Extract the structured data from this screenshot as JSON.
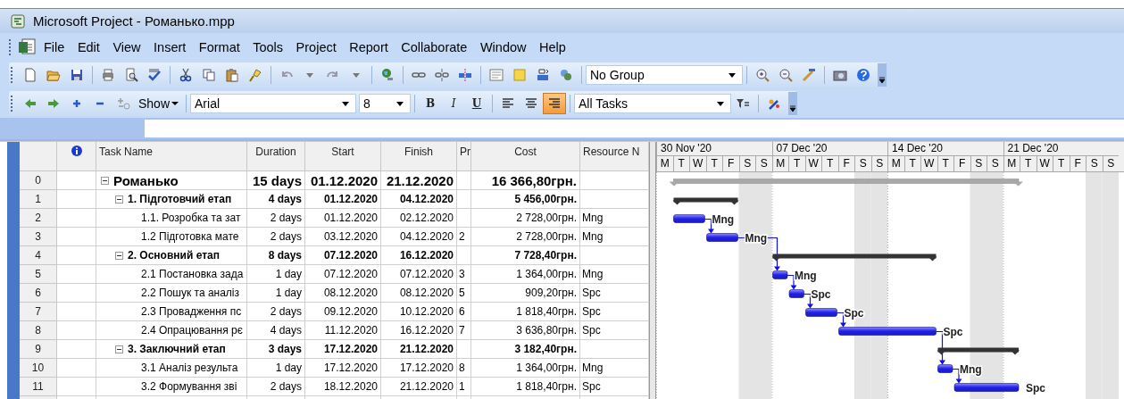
{
  "window": {
    "title": "Microsoft Project - Романько.mpp"
  },
  "menu": [
    "File",
    "Edit",
    "View",
    "Insert",
    "Format",
    "Tools",
    "Project",
    "Report",
    "Collaborate",
    "Window",
    "Help"
  ],
  "standard_toolbar": {
    "group_combo": "No Group"
  },
  "formatting_toolbar": {
    "show_button": "Show",
    "font_combo": "Arial",
    "size_combo": "8",
    "style_buttons": [
      "B",
      "I",
      "U"
    ],
    "align_buttons": [
      {
        "selected": false
      },
      {
        "selected": false
      },
      {
        "selected": true
      }
    ],
    "filter_combo": "All Tasks"
  },
  "table": {
    "columns": [
      "Task Name",
      "Duration",
      "Start",
      "Finish",
      "Pr",
      "Cost",
      "Resource N"
    ],
    "tasks": [
      {
        "id": "0",
        "name": "Романько",
        "duration": "15 days",
        "start": "01.12.2020",
        "finish": "21.12.2020",
        "cost": "16 366,80грн.",
        "expanded": true,
        "children": [
          {
            "id": "1",
            "name": "1. Підготовчий етап",
            "duration": "4 days",
            "start": "01.12.2020",
            "finish": "04.12.2020",
            "cost": "5 456,00грн.",
            "expanded": true,
            "children": [
              {
                "id": "2",
                "name": "1.1. Розробка та зат",
                "duration": "2 days",
                "start": "01.12.2020",
                "finish": "02.12.2020",
                "cost": "2 728,00грн.",
                "resource": "Mng",
                "bar_label": "Mng",
                "link_arrow_in": false
              },
              {
                "id": "3",
                "name": "1.2 Підготовка мате",
                "duration": "2 days",
                "start": "03.12.2020",
                "finish": "04.12.2020",
                "predecessors": "2",
                "cost": "2 728,00грн.",
                "resource": "Mng",
                "bar_label": "Mng",
                "link_arrow_in": true
              }
            ]
          },
          {
            "id": "4",
            "name": "2. Основний етап",
            "duration": "8 days",
            "start": "07.12.2020",
            "finish": "16.12.2020",
            "cost": "7 728,40грн.",
            "expanded": true,
            "children": [
              {
                "id": "5",
                "name": "2.1 Постановка зада",
                "duration": "1 day",
                "start": "07.12.2020",
                "finish": "07.12.2020",
                "predecessors": "3",
                "cost": "1 364,00грн.",
                "resource": "Mng",
                "bar_label": "Mng",
                "link_arrow_in": true
              },
              {
                "id": "6",
                "name": "2.2 Пошук та аналіз",
                "duration": "1 day",
                "start": "08.12.2020",
                "finish": "08.12.2020",
                "predecessors": "5",
                "cost": "909,20грн.",
                "resource": "Spc",
                "bar_label": "Spc",
                "link_arrow_in": true
              },
              {
                "id": "7",
                "name": "2.3 Провадження пс",
                "duration": "2 days",
                "start": "09.12.2020",
                "finish": "10.12.2020",
                "predecessors": "6",
                "cost": "1 818,40грн.",
                "resource": "Spc",
                "bar_label": "Spc",
                "link_arrow_in": true
              },
              {
                "id": "8",
                "name": "2.4 Опрацювання рє",
                "duration": "4 days",
                "start": "11.12.2020",
                "finish": "16.12.2020",
                "predecessors": "7",
                "cost": "3 636,80грн.",
                "resource": "Spc",
                "bar_label": "Spc",
                "link_arrow_in": true
              }
            ]
          },
          {
            "id": "9",
            "name": "3. Заключний етап",
            "duration": "3 days",
            "start": "17.12.2020",
            "finish": "21.12.2020",
            "cost": "3 182,40грн.",
            "expanded": true,
            "children": [
              {
                "id": "10",
                "name": "3.1 Аналіз результа",
                "duration": "1 day",
                "start": "17.12.2020",
                "finish": "17.12.2020",
                "predecessors": "8",
                "cost": "1 364,00грн.",
                "resource": "Mng",
                "bar_label": "Mng",
                "link_arrow_in": true
              },
              {
                "id": "11",
                "name": "3.2 Формування зві",
                "duration": "2 days",
                "start": "18.12.2020",
                "finish": "21.12.2020",
                "predecessors": "1",
                "cost": "1 818,40грн.",
                "resource": "Spc",
                "bar_label": "Spc",
                "link_arrow_in": true
              }
            ]
          }
        ]
      }
    ]
  },
  "timescale": {
    "weeks": [
      "30 Nov '20",
      "07 Dec '20",
      "14 Dec '20",
      "21 Dec '20"
    ],
    "days": [
      "M",
      "T",
      "W",
      "T",
      "F",
      "S",
      "S",
      "M",
      "T",
      "W",
      "T",
      "F",
      "S",
      "S",
      "M",
      "T",
      "W",
      "T",
      "F",
      "S",
      "S",
      "M",
      "T",
      "W",
      "T",
      "F",
      "S",
      "S"
    ]
  }
}
